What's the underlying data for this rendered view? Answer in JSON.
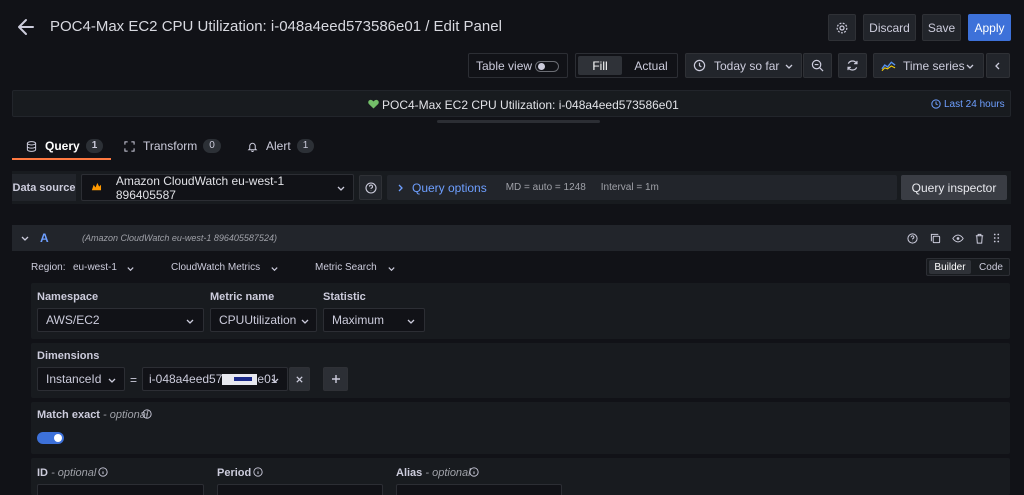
{
  "header": {
    "title": "POC4-Max EC2 CPU Utilization: i-048a4eed573586e01 / Edit Panel",
    "discard": "Discard",
    "save": "Save",
    "apply": "Apply"
  },
  "toolbar": {
    "table_view": "Table view",
    "fill": "Fill",
    "actual": "Actual",
    "time_range": "Today so far",
    "visualization": "Time series"
  },
  "panel": {
    "title": "POC4-Max EC2 CPU Utilization: i-048a4eed573586e01",
    "time_info": "Last 24 hours",
    "status_color": "#73bf69"
  },
  "tabs": [
    {
      "label": "Query",
      "count": "1"
    },
    {
      "label": "Transform",
      "count": "0"
    },
    {
      "label": "Alert",
      "count": "1"
    }
  ],
  "datasource": {
    "label": "Data source",
    "value": "Amazon CloudWatch eu-west-1 896405587",
    "query_options": "Query options",
    "md": "MD = auto = 1248",
    "interval": "Interval = 1m",
    "query_inspector": "Query inspector"
  },
  "query": {
    "ref": "A",
    "source_hint": "(Amazon CloudWatch eu-west-1 896405587524)",
    "region_label": "Region:",
    "region_value": "eu-west-1",
    "service": "CloudWatch Metrics",
    "mode": "Metric Search",
    "builder": "Builder",
    "code": "Code",
    "namespace_label": "Namespace",
    "namespace_value": "AWS/EC2",
    "metric_label": "Metric name",
    "metric_value": "CPUUtilization",
    "statistic_label": "Statistic",
    "statistic_value": "Maximum",
    "dimensions_label": "Dimensions",
    "dim_key": "InstanceId",
    "dim_op": "=",
    "dim_value": "i-048a4eed57",
    "dim_value_suffix": "e01",
    "match_exact_label": "Match exact",
    "match_exact_optional": "- optional",
    "match_exact_enabled": true,
    "id_label": "ID",
    "id_optional": "- optional",
    "period_label": "Period",
    "alias_label": "Alias",
    "alias_optional": "- optional"
  },
  "colors": {
    "accent": "#3d71d9",
    "tab_underline": "#ff7941",
    "link": "#6e9fff",
    "background": "#111217",
    "panel": "#181b1f"
  }
}
